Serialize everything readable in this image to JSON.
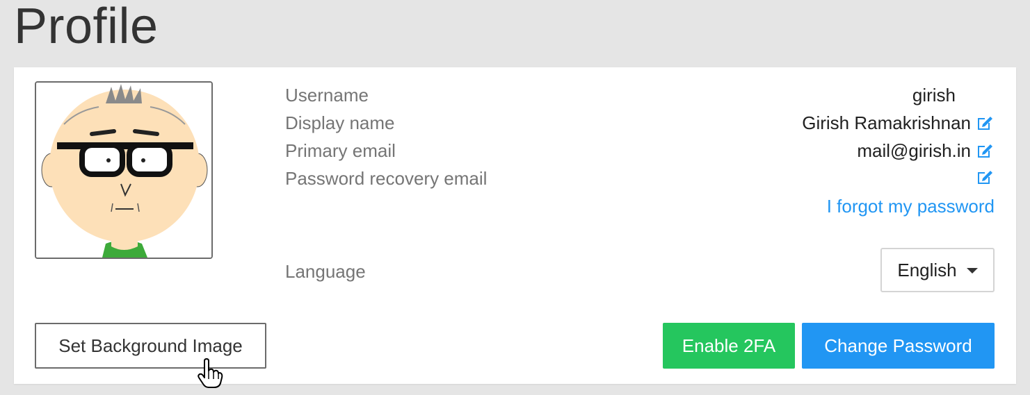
{
  "page": {
    "title": "Profile"
  },
  "profile": {
    "avatar_alt": "avatar-cartoon",
    "fields": {
      "username_label": "Username",
      "username_value": "girish",
      "display_name_label": "Display name",
      "display_name_value": "Girish Ramakrishnan",
      "primary_email_label": "Primary email",
      "primary_email_value": "mail@girish.in",
      "recovery_email_label": "Password recovery email",
      "recovery_email_value": "",
      "forgot_password_link": "I forgot my password",
      "language_label": "Language",
      "language_value": "English"
    },
    "buttons": {
      "set_background": "Set Background Image",
      "enable_2fa": "Enable 2FA",
      "change_password": "Change Password"
    }
  },
  "icons": {
    "edit": "edit-icon",
    "dropdown": "caret-down-icon",
    "cursor": "hand-pointer-icon"
  },
  "colors": {
    "background": "#e5e5e5",
    "card": "#ffffff",
    "link": "#2196f3",
    "primary_button": "#2196f3",
    "success_button": "#25c65e"
  }
}
